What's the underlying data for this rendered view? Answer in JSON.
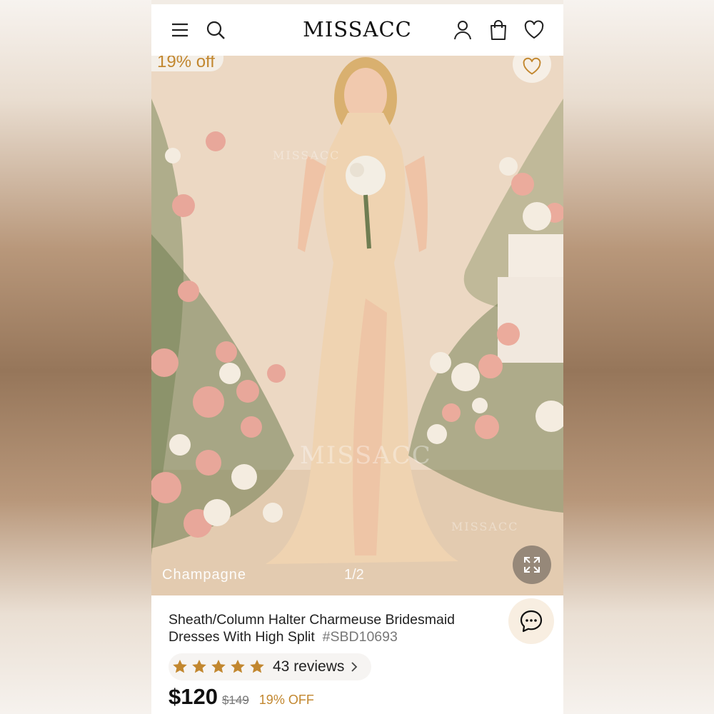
{
  "header": {
    "logo": "MISSACC",
    "icons": [
      "menu-icon",
      "search-icon",
      "account-icon",
      "bag-icon",
      "heart-icon"
    ]
  },
  "hero": {
    "discount_badge": "19% off",
    "color_name": "Champagne",
    "pager": "1/2",
    "watermark": "MISSACC"
  },
  "product": {
    "title": "Sheath/Column Halter Charmeuse Bridesmaid Dresses With High Split",
    "sku": "#SBD10693",
    "rating_stars": 5,
    "reviews": "43 reviews",
    "price": "$120",
    "original_price": "$149",
    "discount": "19% OFF"
  },
  "colors": {
    "accent": "#c2872f",
    "star": "#c2872f",
    "dress": "#efd3b1"
  }
}
